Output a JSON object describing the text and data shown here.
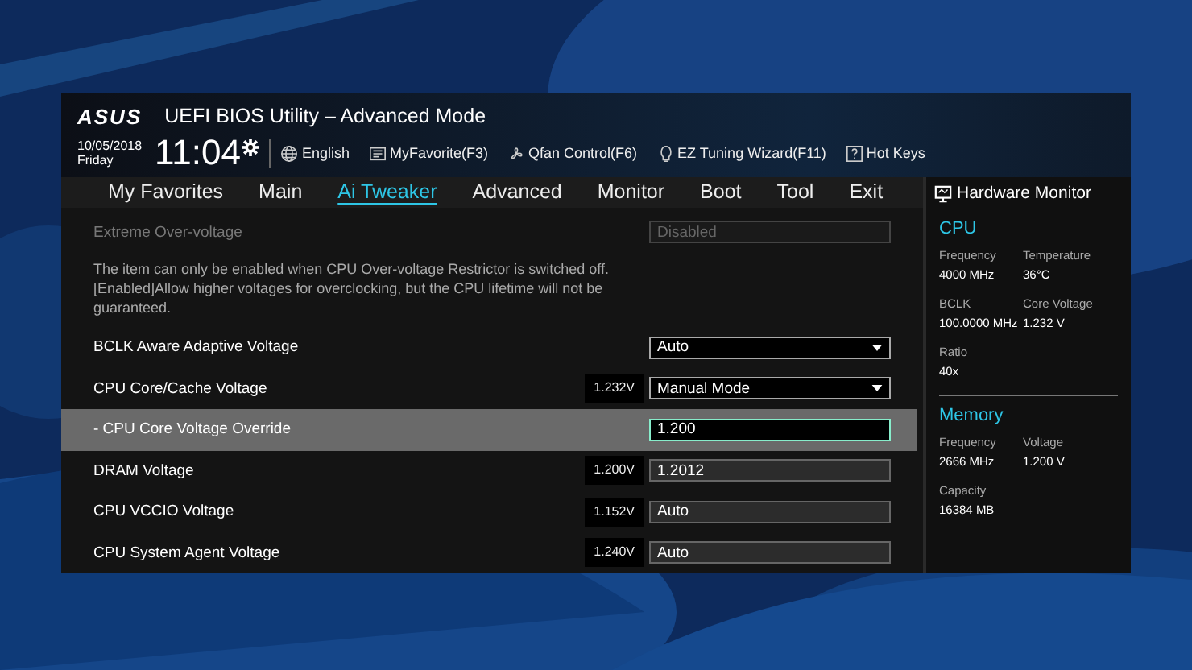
{
  "header": {
    "logo": "ASUS",
    "title": "UEFI BIOS Utility – Advanced Mode",
    "date": "10/05/2018",
    "day": "Friday",
    "time": "11:04",
    "tools": [
      {
        "kind": "language",
        "label": "English"
      },
      {
        "kind": "favorites",
        "label": "MyFavorite(F3)"
      },
      {
        "kind": "fan",
        "label": "Qfan Control(F6)"
      },
      {
        "kind": "wizard",
        "label": "EZ Tuning Wizard(F11)"
      },
      {
        "kind": "help",
        "label": "Hot Keys"
      }
    ]
  },
  "tabs": [
    {
      "label": "My Favorites",
      "selected": false
    },
    {
      "label": "Main",
      "selected": false
    },
    {
      "label": "Ai Tweaker",
      "selected": true
    },
    {
      "label": "Advanced",
      "selected": false
    },
    {
      "label": "Monitor",
      "selected": false
    },
    {
      "label": "Boot",
      "selected": false
    },
    {
      "label": "Tool",
      "selected": false
    },
    {
      "label": "Exit",
      "selected": false
    }
  ],
  "settings": [
    {
      "kind": "field",
      "label": "Extreme Over-voltage",
      "value": "Disabled",
      "disabled": true,
      "selected": false
    },
    {
      "kind": "note",
      "text": "The item can only be enabled when CPU Over-voltage Restrictor is switched off. [Enabled]Allow higher voltages for overclocking, but the CPU lifetime will not be guaranteed."
    },
    {
      "kind": "dropdown",
      "label": "BCLK Aware Adaptive Voltage",
      "value": "Auto",
      "disabled": false,
      "selected": false
    },
    {
      "kind": "dropdown",
      "label": "CPU Core/Cache Voltage",
      "reading": "1.232V",
      "value": "Manual Mode",
      "disabled": false,
      "selected": false
    },
    {
      "kind": "field",
      "label": "- CPU Core Voltage Override",
      "value": "1.200",
      "disabled": false,
      "selected": true
    },
    {
      "kind": "field",
      "label": "DRAM Voltage",
      "reading": "1.200V",
      "value": "1.2012",
      "disabled": false,
      "selected": false
    },
    {
      "kind": "field",
      "label": "CPU VCCIO Voltage",
      "reading": "1.152V",
      "value": "Auto",
      "disabled": false,
      "selected": false
    },
    {
      "kind": "field",
      "label": "CPU System Agent Voltage",
      "reading": "1.240V",
      "value": "Auto",
      "disabled": false,
      "selected": false
    }
  ],
  "hardware_monitor": {
    "title": "Hardware Monitor",
    "sections": [
      {
        "title": "CPU",
        "items": [
          {
            "label": "Frequency",
            "value": "4000 MHz"
          },
          {
            "label": "Temperature",
            "value": "36°C"
          },
          {
            "label": "BCLK",
            "value": "100.0000 MHz"
          },
          {
            "label": "Core Voltage",
            "value": "1.232 V"
          },
          {
            "label": "Ratio",
            "value": "40x"
          }
        ]
      },
      {
        "title": "Memory",
        "items": [
          {
            "label": "Frequency",
            "value": "2666 MHz"
          },
          {
            "label": "Voltage",
            "value": "1.200 V"
          },
          {
            "label": "Capacity",
            "value": "16384 MB"
          }
        ]
      }
    ]
  }
}
